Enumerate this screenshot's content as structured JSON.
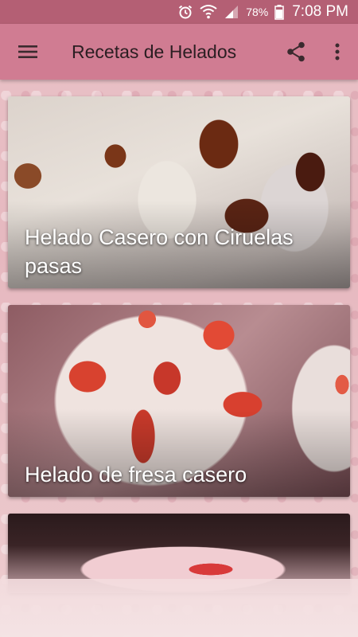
{
  "status_bar": {
    "battery": "78%",
    "time": "7:08 PM",
    "icons": [
      "alarm-icon",
      "wifi-icon",
      "signal-icon",
      "battery-icon"
    ]
  },
  "app_bar": {
    "title": "Recetas de Helados",
    "menu_icon": "hamburger-menu-icon",
    "share_icon": "share-icon",
    "overflow_icon": "more-vert-icon"
  },
  "colors": {
    "status_bar": "#b45f74",
    "app_bar": "#d07c92",
    "background": "#e9c3c8",
    "title_text": "#2b1e22",
    "card_text": "#ffffff"
  },
  "recipes": [
    {
      "title": "Helado Casero con Ciruelas pasas"
    },
    {
      "title": "Helado de fresa casero"
    },
    {
      "title": ""
    }
  ]
}
